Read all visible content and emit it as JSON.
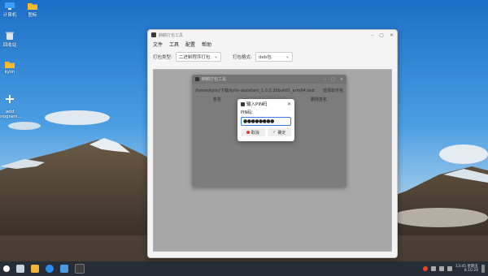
{
  "desktop": {
    "icons": [
      {
        "label": "计算机"
      },
      {
        "label": "图标"
      },
      {
        "label": "回收站"
      },
      {
        "label": "kylin"
      },
      {
        "label": "add\nprogram..."
      }
    ]
  },
  "main_window": {
    "title": "麒麟打包工具",
    "menu": [
      "文件",
      "工具",
      "配置",
      "帮助"
    ],
    "pack_type_label": "打包类型:",
    "pack_type_value": "二进制程序打包",
    "pack_format_label": "打包格式:",
    "pack_format_value": "deb包"
  },
  "inner_dialog": {
    "title": "麒麟打包工具",
    "path": "/home/kylin/下载/kylin-assistant_1.0.0.20build1_arm64.deb",
    "browse_label": "选择软件包",
    "col_signature": "签名",
    "col_delete_signature": "删除签名"
  },
  "pin_dialog": {
    "title": "输入PIN码",
    "label": "PIN码:",
    "value": "●●●●●●●●",
    "cancel_label": "取消",
    "ok_label": "确定"
  },
  "taskbar": {
    "time": "13:45 星期五",
    "date": "8.10.24"
  }
}
